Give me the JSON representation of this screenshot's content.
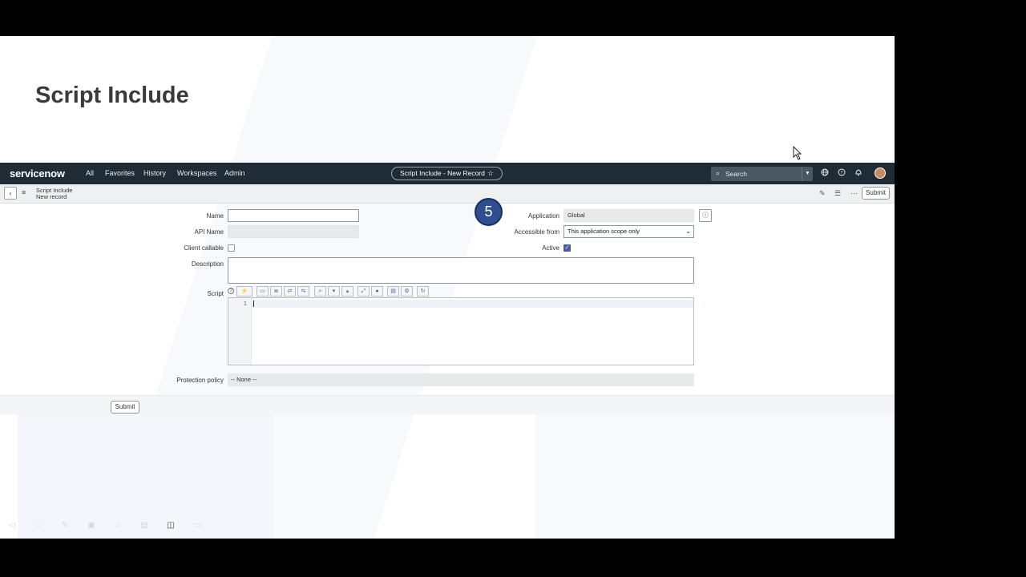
{
  "slide": {
    "title": "Script Include",
    "step_badge": "5"
  },
  "header": {
    "logo": "servicenow",
    "nav": [
      "All",
      "Favorites",
      "History",
      "Workspaces",
      "Admin"
    ],
    "record_pill": "Script Include - New Record",
    "search_label": "Search",
    "icons": [
      "globe-icon",
      "help-icon",
      "bell-icon",
      "avatar"
    ]
  },
  "sub_header": {
    "title_line1": "Script Include",
    "title_line2": "New record",
    "submit_label": "Submit"
  },
  "form": {
    "name_label": "Name",
    "name_value": "",
    "api_name_label": "API Name",
    "api_name_value": "",
    "client_callable_label": "Client callable",
    "client_callable_checked": false,
    "description_label": "Description",
    "description_value": "",
    "script_label": "Script",
    "script_line_number": "1",
    "application_label": "Application",
    "application_value": "Global",
    "accessible_from_label": "Accessible from",
    "accessible_from_value": "This application scope only",
    "active_label": "Active",
    "active_checked": true,
    "protection_policy_label": "Protection policy",
    "protection_policy_value": "-- None --",
    "submit_label": "Submit"
  },
  "colors": {
    "header_bg": "#1f2c36",
    "badge_bg": "#2f4e8f",
    "checkbox_on": "#4b5aa8"
  }
}
